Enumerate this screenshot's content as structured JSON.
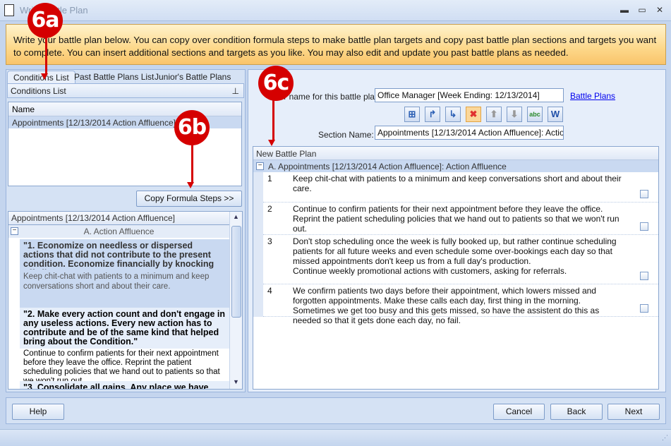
{
  "window": {
    "title": "Write Battle Plan",
    "minimize": "▬",
    "maximize": "▭",
    "close": "✕"
  },
  "banner": {
    "text": "Write your battle plan below. You can copy over condition formula steps to make battle plan targets and copy past battle plan sections and targets you want to complete. You can insert additional sections and targets as you like. You may also edit and update you past battle plans as needed."
  },
  "left": {
    "tabs": [
      "Conditions List",
      "Past Battle Plans List",
      "Junior's Battle Plans"
    ],
    "panel_title": "Conditions List",
    "grid": {
      "header": "Name",
      "rows": [
        "Appointments [12/13/2014 Action Affluence]"
      ]
    },
    "copy_button": "Copy Formula Steps >>",
    "detail": {
      "header": "Appointments [12/13/2014 Action Affluence]",
      "section": "A. Action Affluence",
      "steps": [
        {
          "formula": "\"1. Economize on needless or dispersed actions that did not contribute to the present condition. Economize financially by knocking off all waste.\"",
          "note": "Keep chit-chat with patients to a minimum and keep conversations short and about their care."
        },
        {
          "formula": "\"2. Make every action count and don't engage in any useless actions. Every new action has to contribute and be of the same kind that helped bring about the Condition.\"",
          "note": "Continue to confirm patients for their next appointment before they leave the office. Reprint the patient scheduling policies that we hand out to patients so that we won't run out."
        },
        {
          "formula": "\"3. Consolidate all gains. Any place we have",
          "note": ""
        }
      ]
    }
  },
  "right": {
    "name_label": "Your name for this battle plan:",
    "name_value": "Office Manager [Week Ending: 12/13/2014]",
    "battle_plans_link": "Battle Plans",
    "section_label": "Section Name:",
    "section_value": "Appointments [12/13/2014 Action Affluence]: Action Affluence",
    "grid_header": "New Battle Plan",
    "section_row": "A. Appointments [12/13/2014 Action Affluence]: Action Affluence",
    "targets": [
      {
        "num": "1",
        "text": "Keep chit-chat with patients to a minimum and keep conversations short and about their care.",
        "checked": false
      },
      {
        "num": "2",
        "text": "Continue to confirm patients for their next appointment before they leave the office. Reprint the patient scheduling policies that we hand out to patients so that we won't run out.",
        "checked": false
      },
      {
        "num": "3",
        "text": "Don't stop scheduling once the week is fully booked up, but rather continue scheduling patients for all future weeks and even schedule some over-bookings each day so that missed appointments don't keep us from a full day's production.\nContinue weekly promotional actions with customers, asking for referrals.",
        "checked": false
      },
      {
        "num": "4",
        "text": "We confirm patients two days before their appointment, which lowers missed and forgotten appointments. Make these calls each day, first thing in the morning. Sometimes we get too busy and this gets missed, so have the assistent do this as needed so that it gets done each day, no fail.",
        "checked": false
      }
    ],
    "toolbar": [
      {
        "icon": "add-section-icon",
        "glyph": "⊞"
      },
      {
        "icon": "insert-above-icon",
        "glyph": "↱"
      },
      {
        "icon": "insert-below-icon",
        "glyph": "↳"
      },
      {
        "icon": "delete-icon",
        "glyph": "✖"
      },
      {
        "icon": "move-up-icon",
        "glyph": "⬆"
      },
      {
        "icon": "move-down-icon",
        "glyph": "⬇"
      },
      {
        "icon": "spell-check-icon",
        "glyph": "abc"
      },
      {
        "icon": "word-export-icon",
        "glyph": "W"
      }
    ]
  },
  "footer": {
    "help": "Help",
    "cancel": "Cancel",
    "back": "Back",
    "next": "Next"
  },
  "annotations": {
    "a": "6a",
    "b": "6b",
    "c": "6c"
  },
  "colors": {
    "accent": "#d50000",
    "banner": "#fdd88a",
    "link": "#0000ee"
  }
}
